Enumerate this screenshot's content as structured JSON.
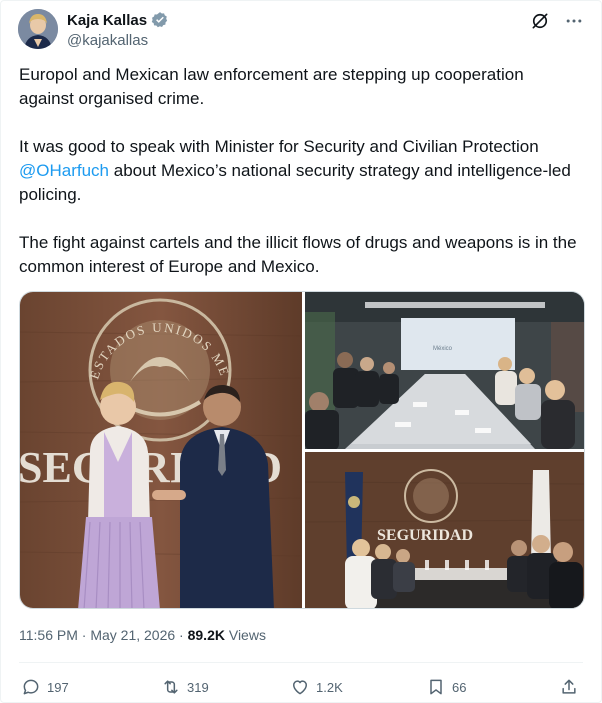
{
  "author": {
    "display_name": "Kaja Kallas",
    "handle": "@kajakallas"
  },
  "post": {
    "paragraph1": "Europol and Mexican law enforcement are stepping up cooperation against organised crime.",
    "paragraph2_before": "It was good to speak with Minister for Security and Civilian Protection ",
    "mention": "@OHarfuch",
    "paragraph2_after": " about Mexico’s national security strategy and intelligence-led policing.",
    "paragraph3": "The fight against cartels and the illicit flows of drugs and weapons is in the common interest of Europe and Mexico."
  },
  "media": {
    "left_photo_wall_text": "SEGURIDAD",
    "left_photo_seal_text": "ESTADOS UNIDOS MEXICANOS",
    "bottom_photo_wall_text": "SEGURIDAD",
    "top_photo_screen_text": "México"
  },
  "meta": {
    "timestamp": "11:56 PM · May 21, 2026 · ",
    "views_count": "89.2K",
    "views_label": " Views"
  },
  "actions": {
    "replies": "197",
    "reposts": "319",
    "likes": "1.2K",
    "bookmarks": "66"
  },
  "colors": {
    "accent": "#1d9bf0",
    "text": "#0f1419",
    "muted": "#536471"
  }
}
